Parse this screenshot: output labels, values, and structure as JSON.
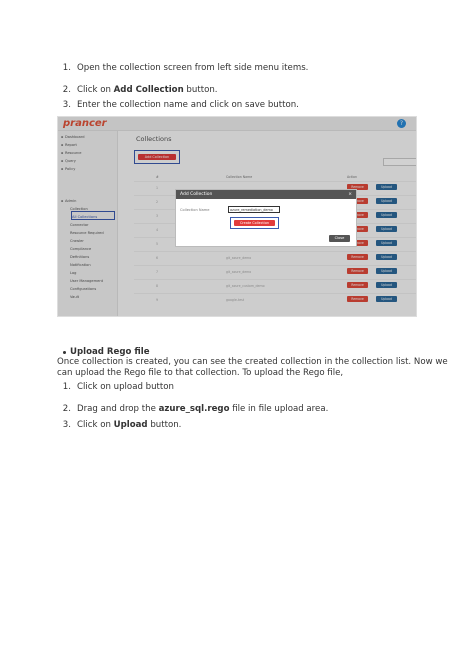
{
  "steps_top": [
    {
      "n": "1.",
      "pre": "Open the collection screen from left side menu items.",
      "bold": "",
      "post": ""
    },
    {
      "n": "2.",
      "pre": "Click on ",
      "bold": "Add Collection",
      "post": " button."
    },
    {
      "n": "3.",
      "pre": "Enter the collection name and click on save button.",
      "bold": "",
      "post": ""
    }
  ],
  "screenshot": {
    "logo": "prancer",
    "help": "?",
    "page_title": "Collections",
    "add_button": "Add Collection",
    "sidebar": [
      "Dashboard",
      "Report",
      "Resource",
      "Query",
      "Policy",
      "Admin",
      "Collection",
      "All Collections",
      "Connector",
      "Resource Required",
      "Crawler",
      "Compliance",
      "Definitions",
      "Notification",
      "Log",
      "User Management",
      "Configurations",
      "Vault"
    ],
    "table_headers": [
      "#",
      "Collection Name",
      "Action"
    ],
    "rows": [
      {
        "idx": "1",
        "name": ""
      },
      {
        "idx": "2",
        "name": ""
      },
      {
        "idx": "3",
        "name": ""
      },
      {
        "idx": "4",
        "name": ""
      },
      {
        "idx": "5",
        "name": ""
      },
      {
        "idx": "6",
        "name": "git_azure_demo"
      },
      {
        "idx": "7",
        "name": "git_azure_demo"
      },
      {
        "idx": "8",
        "name": "git_azure_custom_demo"
      },
      {
        "idx": "9",
        "name": "google-test"
      }
    ],
    "remove_label": "Remove",
    "upload_label": "Upload",
    "modal": {
      "title": "Add Collection",
      "close_x": "×",
      "field_label": "Collection Name",
      "field_value": "azure_remediation_demo",
      "create_button": "Create Collection",
      "close_button": "Close"
    }
  },
  "bullet_heading": "Upload Rego file",
  "para_line1": "Once collection is created, you can see the created collection in the collection list. Now we",
  "para_line2": "can upload the Rego file to that collection. To upload the Rego file,",
  "steps_bottom": [
    {
      "n": "1.",
      "pre": "Click on upload button",
      "bold": "",
      "post": ""
    },
    {
      "n": "2.",
      "pre": "Drag and drop the ",
      "bold": "azure_sql.rego",
      "post": " file in file upload area."
    },
    {
      "n": "3.",
      "pre": "Click on ",
      "bold": "Upload",
      "post": " button."
    }
  ]
}
